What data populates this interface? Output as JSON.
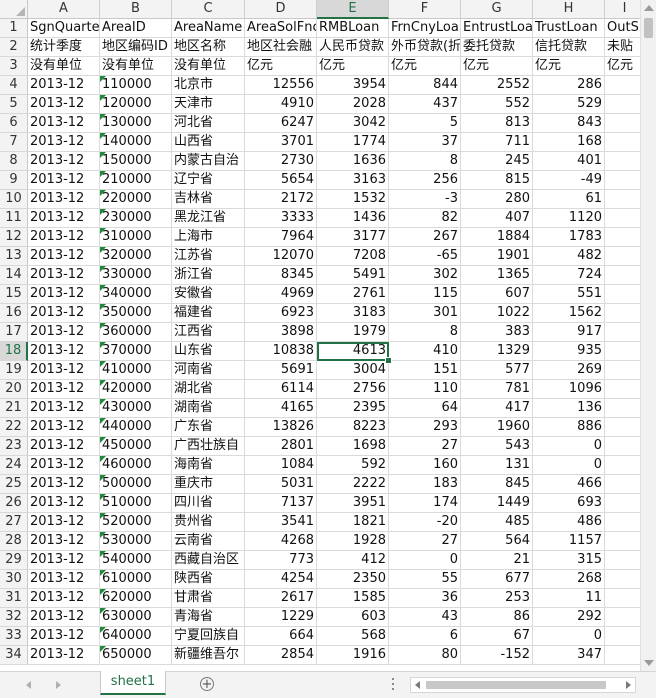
{
  "sheet": {
    "columns": [
      "A",
      "B",
      "C",
      "D",
      "E",
      "F",
      "G",
      "H",
      "I"
    ],
    "active_column": "E",
    "active_row": 18,
    "rows": [
      {
        "n": "1",
        "cells": [
          "SgnQuarter",
          "AreaID",
          "AreaName",
          "AreaSolFnc",
          "RMBLoan",
          "FrnCnyLoan",
          "EntrustLoan",
          "TrustLoan",
          "OutS"
        ]
      },
      {
        "n": "2",
        "cells": [
          "统计季度",
          "地区编码ID",
          "地区名称",
          "地区社会融",
          "人民币贷款",
          "外币贷款(折",
          "委托贷款",
          "信托贷款",
          "未贴"
        ]
      },
      {
        "n": "3",
        "cells": [
          "没有单位",
          "没有单位",
          "没有单位",
          "亿元",
          "亿元",
          "亿元",
          "亿元",
          "亿元",
          "亿元"
        ]
      },
      {
        "n": "4",
        "cells": [
          "2013-12",
          "110000",
          "北京市",
          "12556",
          "3954",
          "844",
          "2552",
          "286",
          ""
        ]
      },
      {
        "n": "5",
        "cells": [
          "2013-12",
          "120000",
          "天津市",
          "4910",
          "2028",
          "437",
          "552",
          "529",
          ""
        ]
      },
      {
        "n": "6",
        "cells": [
          "2013-12",
          "130000",
          "河北省",
          "6247",
          "3042",
          "5",
          "813",
          "843",
          ""
        ]
      },
      {
        "n": "7",
        "cells": [
          "2013-12",
          "140000",
          "山西省",
          "3701",
          "1774",
          "37",
          "711",
          "168",
          ""
        ]
      },
      {
        "n": "8",
        "cells": [
          "2013-12",
          "150000",
          "内蒙古自治",
          "2730",
          "1636",
          "8",
          "245",
          "401",
          ""
        ]
      },
      {
        "n": "9",
        "cells": [
          "2013-12",
          "210000",
          "辽宁省",
          "5654",
          "3163",
          "256",
          "815",
          "-49",
          ""
        ]
      },
      {
        "n": "10",
        "cells": [
          "2013-12",
          "220000",
          "吉林省",
          "2172",
          "1532",
          "-3",
          "280",
          "61",
          ""
        ]
      },
      {
        "n": "11",
        "cells": [
          "2013-12",
          "230000",
          "黑龙江省",
          "3333",
          "1436",
          "82",
          "407",
          "1120",
          ""
        ]
      },
      {
        "n": "12",
        "cells": [
          "2013-12",
          "310000",
          "上海市",
          "7964",
          "3177",
          "267",
          "1884",
          "1783",
          ""
        ]
      },
      {
        "n": "13",
        "cells": [
          "2013-12",
          "320000",
          "江苏省",
          "12070",
          "7208",
          "-65",
          "1901",
          "482",
          ""
        ]
      },
      {
        "n": "14",
        "cells": [
          "2013-12",
          "330000",
          "浙江省",
          "8345",
          "5491",
          "302",
          "1365",
          "724",
          ""
        ]
      },
      {
        "n": "15",
        "cells": [
          "2013-12",
          "340000",
          "安徽省",
          "4969",
          "2761",
          "115",
          "607",
          "551",
          ""
        ]
      },
      {
        "n": "16",
        "cells": [
          "2013-12",
          "350000",
          "福建省",
          "6923",
          "3183",
          "301",
          "1022",
          "1562",
          ""
        ]
      },
      {
        "n": "17",
        "cells": [
          "2013-12",
          "360000",
          "江西省",
          "3898",
          "1979",
          "8",
          "383",
          "917",
          ""
        ]
      },
      {
        "n": "18",
        "cells": [
          "2013-12",
          "370000",
          "山东省",
          "10838",
          "4613",
          "410",
          "1329",
          "935",
          ""
        ]
      },
      {
        "n": "19",
        "cells": [
          "2013-12",
          "410000",
          "河南省",
          "5691",
          "3004",
          "151",
          "577",
          "269",
          ""
        ]
      },
      {
        "n": "20",
        "cells": [
          "2013-12",
          "420000",
          "湖北省",
          "6114",
          "2756",
          "110",
          "781",
          "1096",
          ""
        ]
      },
      {
        "n": "21",
        "cells": [
          "2013-12",
          "430000",
          "湖南省",
          "4165",
          "2395",
          "64",
          "417",
          "136",
          ""
        ]
      },
      {
        "n": "22",
        "cells": [
          "2013-12",
          "440000",
          "广东省",
          "13826",
          "8223",
          "293",
          "1960",
          "886",
          ""
        ]
      },
      {
        "n": "23",
        "cells": [
          "2013-12",
          "450000",
          "广西壮族自",
          "2801",
          "1698",
          "27",
          "543",
          "0",
          ""
        ]
      },
      {
        "n": "24",
        "cells": [
          "2013-12",
          "460000",
          "海南省",
          "1084",
          "592",
          "160",
          "131",
          "0",
          ""
        ]
      },
      {
        "n": "25",
        "cells": [
          "2013-12",
          "500000",
          "重庆市",
          "5031",
          "2222",
          "183",
          "845",
          "466",
          ""
        ]
      },
      {
        "n": "26",
        "cells": [
          "2013-12",
          "510000",
          "四川省",
          "7137",
          "3951",
          "174",
          "1449",
          "693",
          ""
        ]
      },
      {
        "n": "27",
        "cells": [
          "2013-12",
          "520000",
          "贵州省",
          "3541",
          "1821",
          "-20",
          "485",
          "486",
          ""
        ]
      },
      {
        "n": "28",
        "cells": [
          "2013-12",
          "530000",
          "云南省",
          "4268",
          "1928",
          "27",
          "564",
          "1157",
          ""
        ]
      },
      {
        "n": "29",
        "cells": [
          "2013-12",
          "540000",
          "西藏自治区",
          "773",
          "412",
          "0",
          "21",
          "315",
          ""
        ]
      },
      {
        "n": "30",
        "cells": [
          "2013-12",
          "610000",
          "陕西省",
          "4254",
          "2350",
          "55",
          "677",
          "268",
          ""
        ]
      },
      {
        "n": "31",
        "cells": [
          "2013-12",
          "620000",
          "甘肃省",
          "2617",
          "1585",
          "36",
          "253",
          "11",
          ""
        ]
      },
      {
        "n": "32",
        "cells": [
          "2013-12",
          "630000",
          "青海省",
          "1229",
          "603",
          "43",
          "86",
          "292",
          ""
        ]
      },
      {
        "n": "33",
        "cells": [
          "2013-12",
          "640000",
          "宁夏回族自",
          "664",
          "568",
          "6",
          "67",
          "0",
          ""
        ]
      },
      {
        "n": "34",
        "cells": [
          "2013-12",
          "650000",
          "新疆维吾尔",
          "2854",
          "1916",
          "80",
          "-152",
          "347",
          ""
        ]
      }
    ]
  },
  "bottom_bar": {
    "sheet_tab": "sheet1",
    "add_sheet_symbol": "+"
  },
  "colors": {
    "accent": "#217346",
    "grid_line": "#dadada",
    "header_bg": "#f3f3f3"
  }
}
